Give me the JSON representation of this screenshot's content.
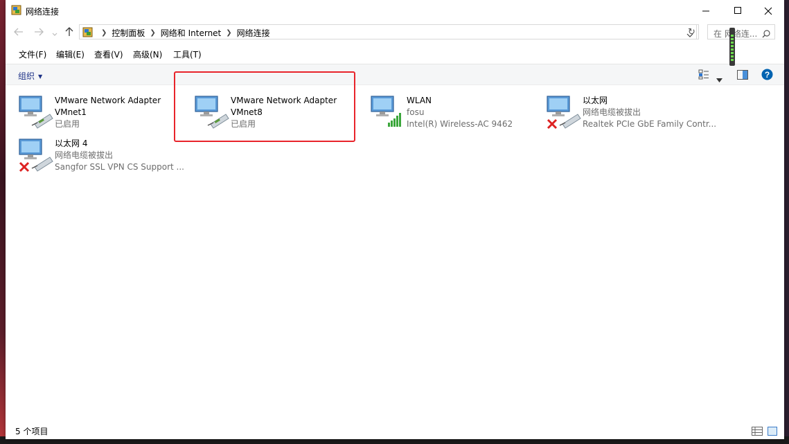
{
  "window": {
    "title": "网络连接"
  },
  "address": {
    "crumbs": [
      "控制面板",
      "网络和 Internet",
      "网络连接"
    ],
    "search_placeholder": "在 网络连...",
    "refresh_symbol": "↻"
  },
  "menu": [
    "文件(F)",
    "编辑(E)",
    "查看(V)",
    "高级(N)",
    "工具(T)"
  ],
  "command": {
    "organize": "组织"
  },
  "adapters": [
    {
      "name": "VMware Network Adapter",
      "line2": "VMnet1",
      "line3": "已启用",
      "icon": "network-adapter-icon",
      "status": "enabled"
    },
    {
      "name": "VMware Network Adapter",
      "line2": "VMnet8",
      "line3": "已启用",
      "icon": "network-adapter-icon",
      "status": "enabled"
    },
    {
      "name": "WLAN",
      "line2": "fosu",
      "line3": "Intel(R) Wireless-AC 9462",
      "icon": "wifi-adapter-icon",
      "status": "connected"
    },
    {
      "name": "以太网",
      "line2": "网络电缆被拔出",
      "line3": "Realtek PCIe GbE Family Contr...",
      "icon": "ethernet-disconnected-icon",
      "status": "disconnected"
    },
    {
      "name": "以太网 4",
      "line2": "网络电缆被拔出",
      "line3": "Sangfor SSL VPN CS Support ...",
      "icon": "ethernet-disconnected-icon",
      "status": "disconnected"
    }
  ],
  "status": {
    "item_count": "5 个项目"
  },
  "colors": {
    "highlight": "#e8232a",
    "link_blue": "#1e3287",
    "help_blue": "#0063b1"
  }
}
